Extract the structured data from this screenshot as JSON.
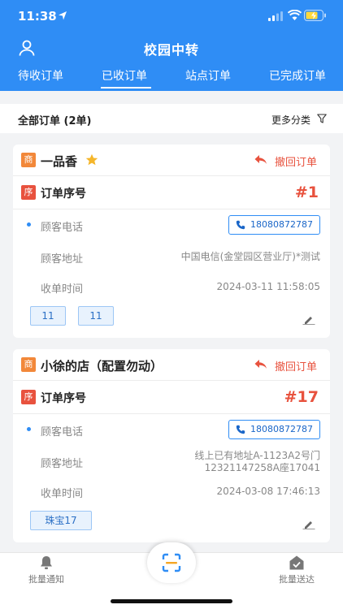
{
  "status_bar": {
    "time": "11:38"
  },
  "header": {
    "title": "校园中转"
  },
  "tabs": [
    {
      "label": "待收订单"
    },
    {
      "label": "已收订单",
      "active": true
    },
    {
      "label": "站点订单"
    },
    {
      "label": "已完成订单"
    }
  ],
  "filter": {
    "all_orders": "全部订单 (2单)",
    "more_categories": "更多分类"
  },
  "shop_badge": "商",
  "seq_badge": "序",
  "labels": {
    "seq": "订单序号",
    "revoke": "撤回订单",
    "phone": "顾客电话",
    "address": "顾客地址",
    "time": "收单时间"
  },
  "orders": [
    {
      "shop": "一品香",
      "starred": true,
      "seq": "#1",
      "phone": "18080872787",
      "address": "中国电信(金堂园区营业厅)*测试",
      "time": "2024-03-11 11:58:05",
      "tags": [
        "11",
        "11"
      ]
    },
    {
      "shop": "小徐的店（配置勿动）",
      "starred": false,
      "seq": "#17",
      "phone": "18080872787",
      "address_line1": "线上已有地址A-1123A2号门",
      "address_line2": "12321147258A座17041",
      "time": "2024-03-08 17:46:13",
      "tags": [
        "珠宝17"
      ]
    }
  ],
  "bottom_nav": {
    "left": "批量通知",
    "right": "批量送达"
  },
  "colors": {
    "primary": "#2f8df5",
    "accent": "#e8523e",
    "shop_badge": "#f2883a"
  }
}
